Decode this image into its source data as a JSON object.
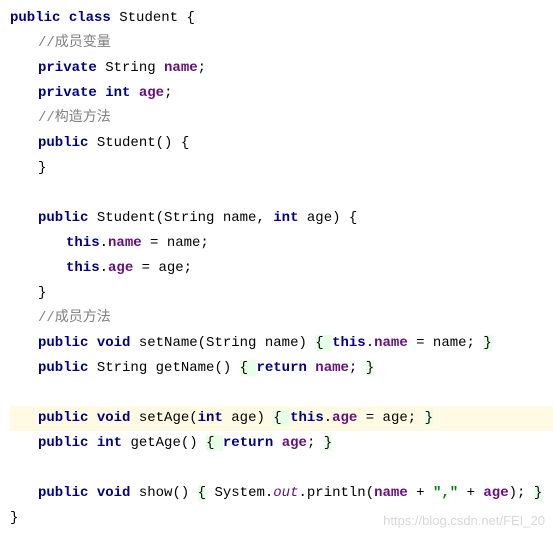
{
  "code": {
    "l1_kw1": "public",
    "l1_kw2": "class",
    "l1_name": "Student",
    "l1_brace": " {",
    "l2_comment": "//成员变量",
    "l3_kw": "private",
    "l3_type": "String ",
    "l3_var": "name",
    "l3_semi": ";",
    "l4_kw1": "private",
    "l4_kw2": "int",
    "l4_var": "age",
    "l4_semi": ";",
    "l5_comment": "//构造方法",
    "l6_kw": "public",
    "l6_name": "Student() {",
    "l7_brace": "}",
    "l9_kw1": "public",
    "l9_text1": "Student(String name, ",
    "l9_kw2": "int",
    "l9_text2": " age) {",
    "l10_kw": "this",
    "l10_dot": ".",
    "l10_field": "name",
    "l10_rest": " = name;",
    "l11_kw": "this",
    "l11_dot": ".",
    "l11_field": "age",
    "l11_rest": " = age;",
    "l12_brace": "}",
    "l13_comment": "//成员方法",
    "l14_kw1": "public",
    "l14_kw2": "void",
    "l14_text1": "setName(String name) ",
    "l14_hl1": "{ ",
    "l14_kw3": "this",
    "l14_dot": ".",
    "l14_field": "name",
    "l14_text2": " = name; ",
    "l14_hl2": "}",
    "l15_kw": "public",
    "l15_text1": "String getName() ",
    "l15_hl1": "{ ",
    "l15_kw2": "return",
    "l15_sp": " ",
    "l15_field": "name",
    "l15_text2": "; ",
    "l15_hl2": "}",
    "l17_kw1": "public",
    "l17_kw2": "void",
    "l17_text1": "setAge(",
    "l17_kw3": "int",
    "l17_text2": " age) ",
    "l17_hl1": "{ ",
    "l17_kw4": "this",
    "l17_dot": ".",
    "l17_field": "age",
    "l17_text3": " = age; ",
    "l17_hl2": "}",
    "l18_kw1": "public",
    "l18_kw2": "int",
    "l18_text1": "getAge() ",
    "l18_hl1": "{ ",
    "l18_kw3": "return",
    "l18_sp": " ",
    "l18_field": "age",
    "l18_text2": "; ",
    "l18_hl2": "}",
    "l20_kw1": "public",
    "l20_kw2": "void",
    "l20_text1": "show() ",
    "l20_hl1": "{",
    "l20_text2": " System.",
    "l20_out": "out",
    "l20_text3": ".println(",
    "l20_field1": "name",
    "l20_plus1": " + ",
    "l20_str": "\",\"",
    "l20_plus2": " + ",
    "l20_field2": "age",
    "l20_text4": "); ",
    "l20_hl2": "}",
    "l21_brace": "}"
  },
  "watermark": "https://blog.csdn.net/FEI_20"
}
